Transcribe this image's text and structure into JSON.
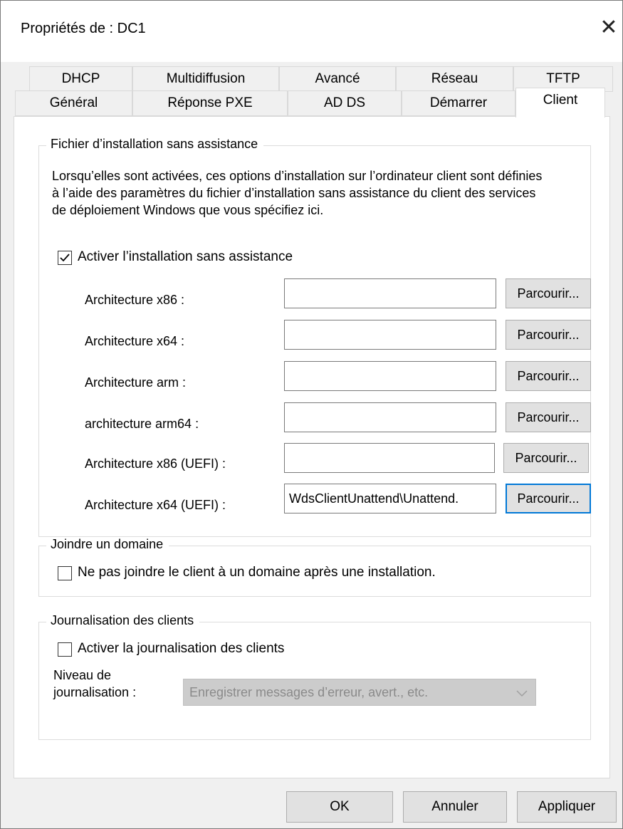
{
  "window": {
    "title": "Propriétés de : DC1"
  },
  "tabs_row1": [
    "DHCP",
    "Multidiffusion",
    "Avancé",
    "Réseau",
    "TFTP"
  ],
  "tabs_row2": [
    "Général",
    "Réponse PXE",
    "AD DS",
    "Démarrer",
    "Client"
  ],
  "active_tab": "Client",
  "unattend_group": {
    "legend": "Fichier d’installation sans assistance",
    "description": "Lorsqu’elles sont activées, ces options d’installation sur l’ordinateur client sont définies à l’aide des paramètres du fichier d’installation sans assistance du client des services de déploiement Windows que vous spécifiez ici.",
    "enable_label": "Activer l’installation sans assistance",
    "enable_checked": true,
    "rows": [
      {
        "label": "Architecture x86 :",
        "value": "",
        "button": "Parcourir..."
      },
      {
        "label": "Architecture x64 :",
        "value": "",
        "button": "Parcourir..."
      },
      {
        "label": "Architecture arm :",
        "value": "",
        "button": "Parcourir..."
      },
      {
        "label": "architecture arm64 :",
        "value": "",
        "button": "Parcourir..."
      },
      {
        "label": "Architecture x86 (UEFI) :",
        "value": "",
        "button": "Parcourir..."
      },
      {
        "label": "Architecture x64 (UEFI) :",
        "value": "WdsClientUnattend\\Unattend.",
        "button": "Parcourir..."
      }
    ]
  },
  "domain_group": {
    "legend": "Joindre un domaine",
    "checkbox_label": "Ne pas joindre le client à un domaine après une installation.",
    "checked": false
  },
  "logging_group": {
    "legend": "Journalisation des clients",
    "checkbox_label": "Activer la journalisation des clients",
    "checked": false,
    "level_label_line1": "Niveau de",
    "level_label_line2": "journalisation :",
    "level_value": "Enregistrer messages d’erreur, avert., etc."
  },
  "footer": {
    "ok": "OK",
    "cancel": "Annuler",
    "apply": "Appliquer"
  }
}
